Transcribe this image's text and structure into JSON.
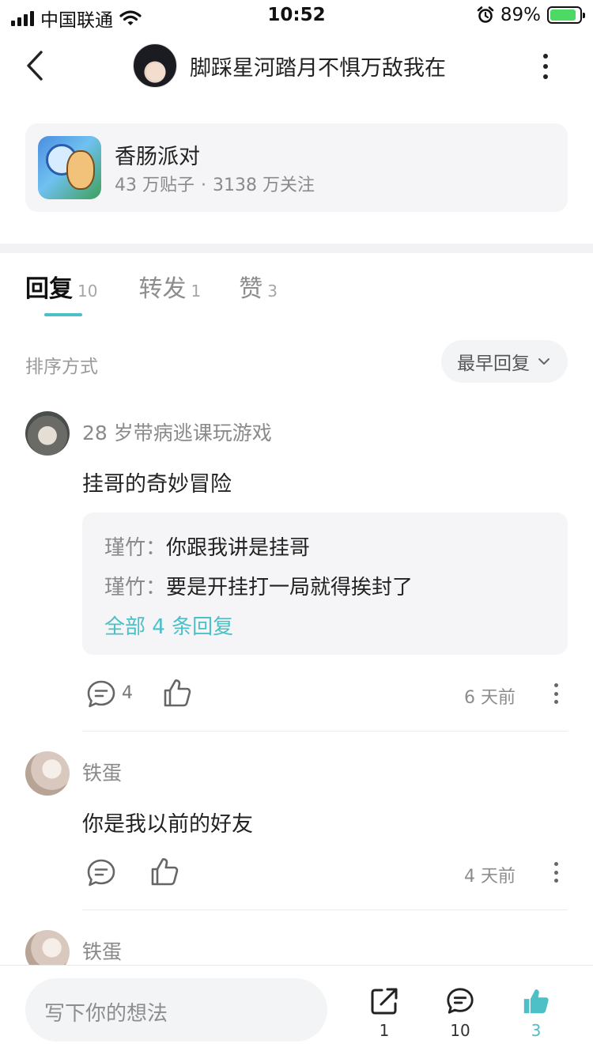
{
  "status_bar": {
    "carrier": "中国联通",
    "time": "10:52",
    "battery": "89%",
    "battery_level": 0.89
  },
  "header": {
    "title": "脚踩星河踏月不惧万敌我在"
  },
  "forum": {
    "name": "香肠派对",
    "posts": "43 万贴子",
    "dot": "·",
    "followers": "3138 万关注"
  },
  "tabs": [
    {
      "label": "回复",
      "count": "10"
    },
    {
      "label": "转发",
      "count": "1"
    },
    {
      "label": "赞",
      "count": "3"
    }
  ],
  "sort": {
    "label": "排序方式",
    "selected": "最早回复"
  },
  "comments": [
    {
      "username": "28 岁带病逃课玩游戏",
      "content": "挂哥的奇妙冒险",
      "replies": [
        {
          "name": "瑾竹",
          "text": "你跟我讲是挂哥"
        },
        {
          "name": "瑾竹",
          "text": "要是开挂打一局就得挨封了"
        }
      ],
      "all_replies": "全部 4 条回复",
      "reply_count": "4",
      "time": "6 天前"
    },
    {
      "username": "铁蛋",
      "content": "你是我以前的好友",
      "time": "4 天前"
    },
    {
      "username": "铁蛋"
    }
  ],
  "bottom_bar": {
    "placeholder": "写下你的想法",
    "share_count": "1",
    "comment_count": "10",
    "like_count": "3"
  },
  "colors": {
    "accent": "#4cbfc7",
    "battery_fill": "#4cd964"
  }
}
